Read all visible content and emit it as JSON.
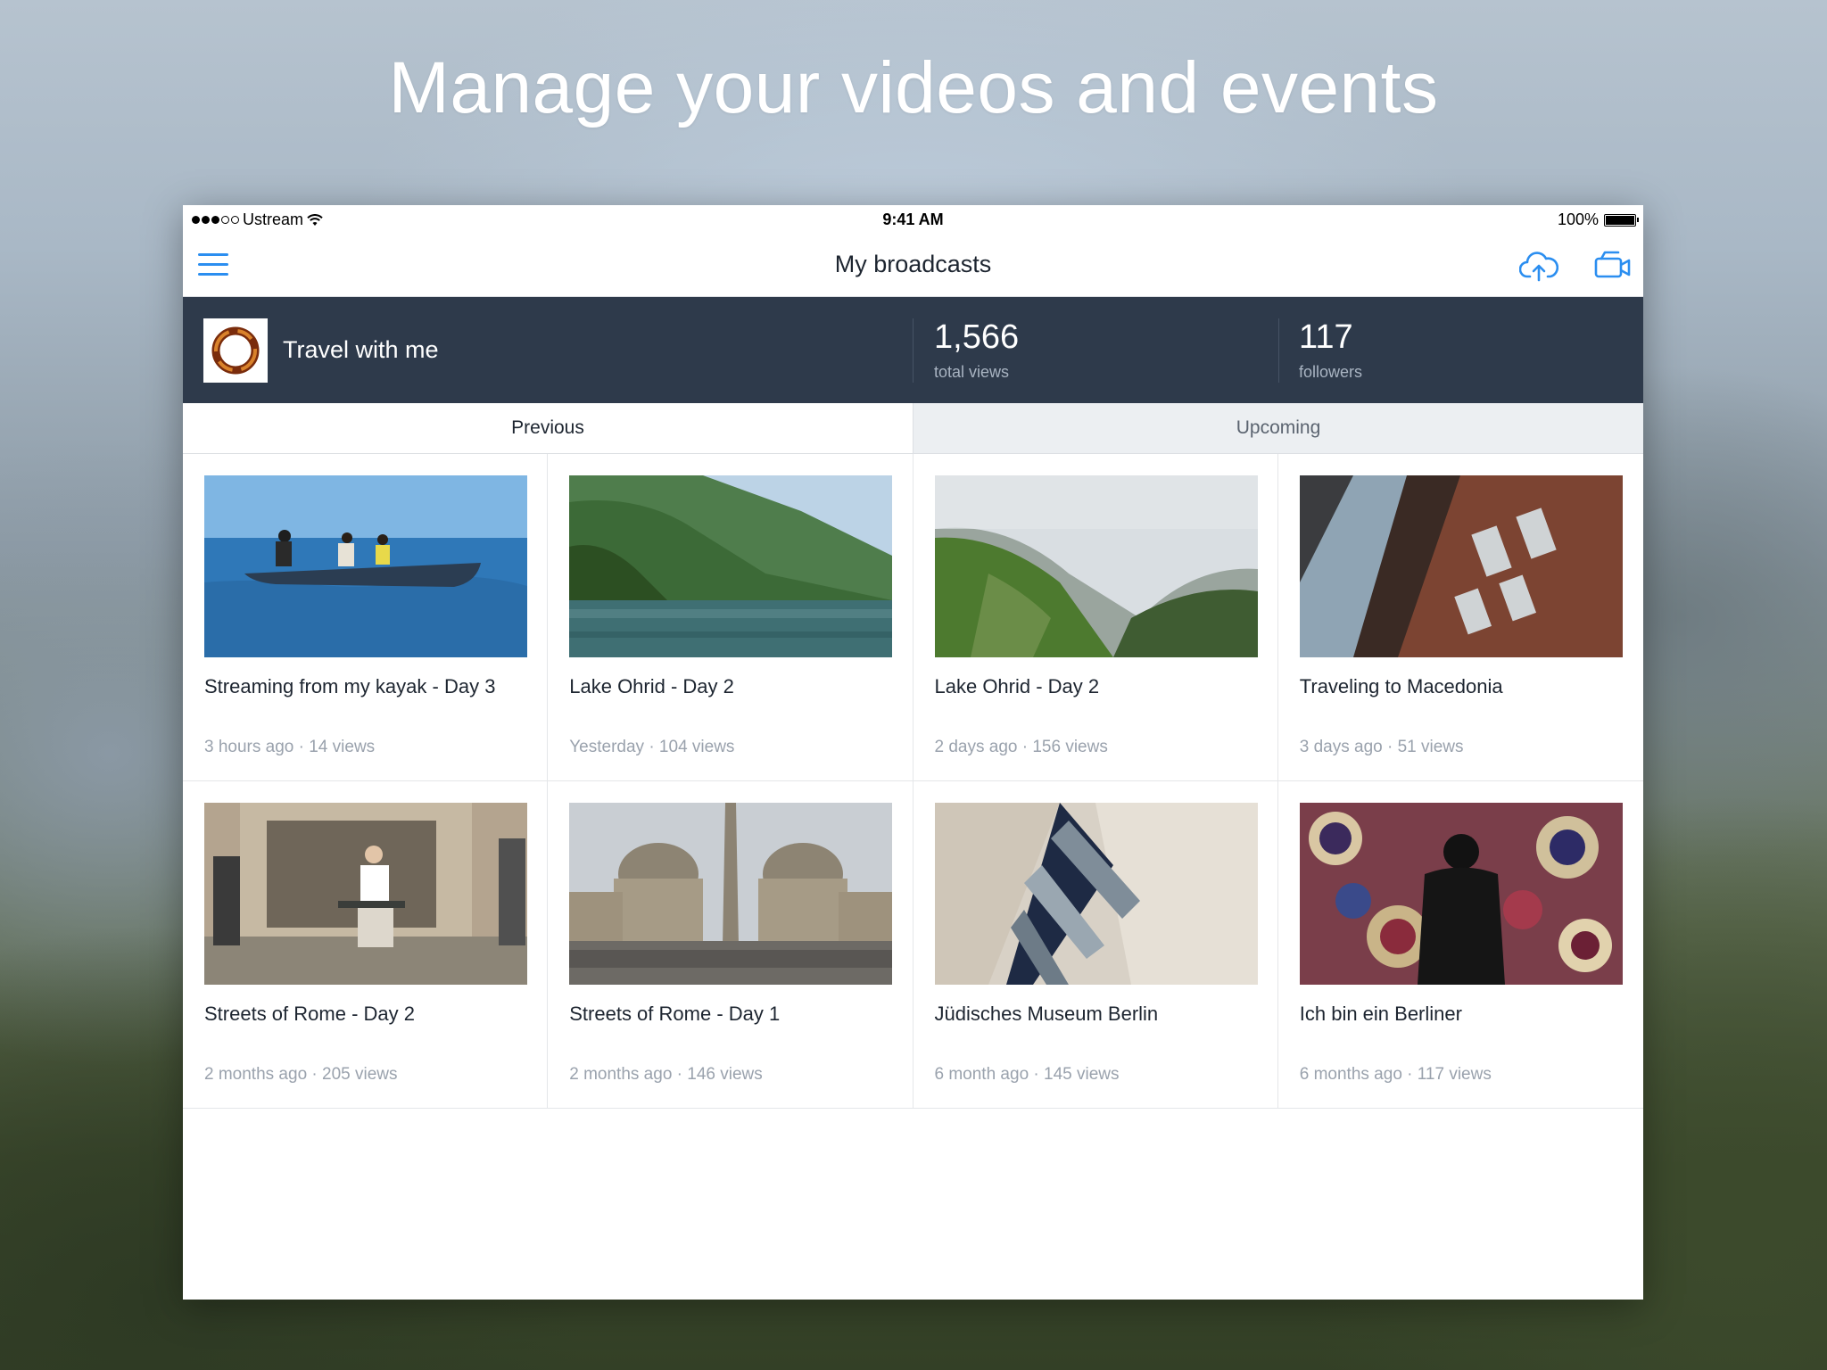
{
  "headline": "Manage your videos and events",
  "status_bar": {
    "carrier": "Ustream",
    "time": "9:41 AM",
    "battery": "100%"
  },
  "nav": {
    "title": "My broadcasts"
  },
  "channel": {
    "name": "Travel with me",
    "total_views": "1,566",
    "total_views_label": "total views",
    "followers": "117",
    "followers_label": "followers"
  },
  "tabs": [
    {
      "label": "Previous",
      "active": true
    },
    {
      "label": "Upcoming",
      "active": false
    }
  ],
  "videos": [
    {
      "title": "Streaming from my kayak - Day 3",
      "meta": "3 hours ago · 14 views",
      "thumb": "kayak-scene"
    },
    {
      "title": "Lake Ohrid - Day 2",
      "meta": "Yesterday · 104 views",
      "thumb": "lake-scene"
    },
    {
      "title": "Lake Ohrid - Day 2",
      "meta": "2 days ago · 156 views",
      "thumb": "foggy-mountain-scene"
    },
    {
      "title": "Traveling to Macedonia",
      "meta": "3 days ago · 51 views",
      "thumb": "old-building-scene"
    },
    {
      "title": "Streets of Rome - Day 2",
      "meta": "2 months ago · 205 views",
      "thumb": "street-man-scene"
    },
    {
      "title": "Streets of Rome - Day 1",
      "meta": "2 months ago · 146 views",
      "thumb": "piazza-scene"
    },
    {
      "title": "Jüdisches Museum Berlin",
      "meta": "6 month ago · 145 views",
      "thumb": "museum-architecture-scene"
    },
    {
      "title": "Ich bin ein Berliner",
      "meta": "6 months ago · 117 views",
      "thumb": "graffiti-wall-scene"
    }
  ],
  "colors": {
    "accent": "#2b8ef0",
    "channel_bg": "#2e3a4b",
    "muted_text": "#9aa2ad"
  }
}
